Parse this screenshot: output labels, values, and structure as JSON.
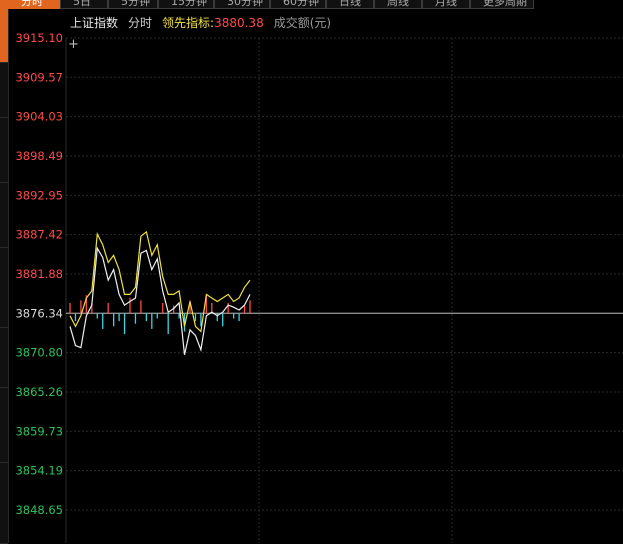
{
  "tabs": [
    {
      "label": "分时",
      "active": true
    },
    {
      "label": "5日",
      "active": false
    },
    {
      "label": "5分钟",
      "active": false
    },
    {
      "label": "15分钟",
      "active": false
    },
    {
      "label": "30分钟",
      "active": false
    },
    {
      "label": "60分钟",
      "active": false
    },
    {
      "label": "日线",
      "active": false
    },
    {
      "label": "周线",
      "active": false
    },
    {
      "label": "月线",
      "active": false
    },
    {
      "label": "更多周期",
      "active": false
    }
  ],
  "legend": {
    "index_name": "上证指数",
    "mode": "分时",
    "lead_label": "领先指标:",
    "lead_value": "3880.38",
    "volume_label": "成交额(元)"
  },
  "colors": {
    "up": "#ff4a4a",
    "down": "#2ec25a",
    "grid": "#2a2a2a",
    "base": "#8a8a8a",
    "price_line": "#f0f0f0",
    "lead_line": "#f0e040",
    "vol_up": "#ff4a4a",
    "vol_down": "#3ad6e6"
  },
  "chart_data": {
    "type": "line",
    "base_price": 3876.34,
    "ylim": [
      3845.12,
      3917.56
    ],
    "y_ticks": [
      3915.1,
      3909.57,
      3904.03,
      3898.49,
      3892.95,
      3887.42,
      3881.88,
      3876.34,
      3870.8,
      3865.26,
      3859.73,
      3854.19,
      3848.65
    ],
    "series": [
      {
        "values": [
          3874.5,
          3871.8,
          3871.5,
          3876.0,
          3877.5,
          3885.5,
          3884.2,
          3881.0,
          3882.5,
          3879.0,
          3877.5,
          3878.0,
          3878.5,
          3884.8,
          3885.2,
          3882.5,
          3884.0,
          3879.5,
          3876.5,
          3877.0,
          3877.8,
          3870.5,
          3874.0,
          3873.2,
          3871.2,
          3876.0,
          3876.5,
          3876.0,
          3876.5,
          3877.5,
          3877.2,
          3876.8,
          3877.5,
          3879.0
        ]
      },
      {
        "values": [
          3876.0,
          3874.5,
          3876.0,
          3878.5,
          3879.5,
          3887.5,
          3886.0,
          3883.5,
          3884.5,
          3882.5,
          3879.0,
          3879.0,
          3880.0,
          3887.2,
          3887.8,
          3884.5,
          3886.0,
          3881.5,
          3879.0,
          3879.0,
          3879.5,
          3874.5,
          3878.0,
          3874.5,
          3873.8,
          3879.0,
          3878.5,
          3878.0,
          3878.5,
          3879.0,
          3878.0,
          3878.5,
          3880.0,
          3881.0
        ]
      }
    ],
    "volume": [
      4,
      -3,
      5,
      7,
      4,
      -2,
      -6,
      4,
      -5,
      -3,
      -8,
      6,
      -4,
      5,
      -3,
      -6,
      -2,
      4,
      -8,
      3,
      -2,
      -7,
      5,
      -3,
      -5,
      7,
      4,
      -3,
      -5,
      4,
      -2,
      -3,
      3,
      5
    ]
  }
}
